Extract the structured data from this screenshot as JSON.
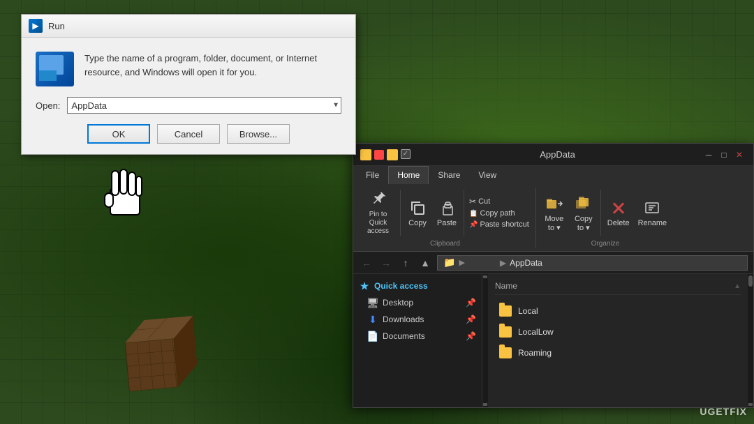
{
  "background": {
    "color": "#2d4a1e"
  },
  "run_dialog": {
    "title": "Run",
    "description": "Type the name of a program, folder, document, or Internet resource, and Windows will open it for you.",
    "open_label": "Open:",
    "input_value": "AppData",
    "ok_label": "OK",
    "cancel_label": "Cancel",
    "browse_label": "Browse..."
  },
  "explorer": {
    "title": "AppData",
    "tabs": {
      "file": "File",
      "home": "Home",
      "share": "Share",
      "view": "View"
    },
    "ribbon": {
      "pin_label": "Pin to Quick\naccess",
      "copy_label": "Copy",
      "paste_label": "Paste",
      "cut_label": "Cut",
      "copy_path_label": "Copy path",
      "paste_shortcut_label": "Paste shortcut",
      "move_to_label": "Move\nto",
      "copy_to_label": "Copy\nto",
      "delete_label": "Delete",
      "rename_label": "Rename",
      "clipboard_group": "Clipboard",
      "organize_group": "Organize"
    },
    "address": {
      "path": "AppData",
      "breadcrumb": "► AppData"
    },
    "sidebar": {
      "quick_access_label": "Quick access",
      "desktop_label": "Desktop",
      "downloads_label": "Downloads",
      "documents_label": "Documents"
    },
    "files": {
      "name_header": "Name",
      "sort_indicator": "▲",
      "items": [
        {
          "name": "Local",
          "type": "folder"
        },
        {
          "name": "LocalLow",
          "type": "folder"
        },
        {
          "name": "Roaming",
          "type": "folder"
        }
      ]
    }
  },
  "watermark": {
    "text": "UGETFIX"
  }
}
